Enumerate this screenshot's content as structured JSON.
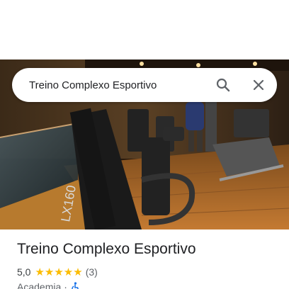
{
  "search": {
    "query": "Treino Complexo Esportivo",
    "search_icon": "search-icon",
    "close_icon": "close-icon"
  },
  "photo": {
    "subject": "gym-interior-photo"
  },
  "place": {
    "title": "Treino Complexo Esportivo",
    "rating": "5,0",
    "stars": "★★★★★",
    "star_value": 5,
    "review_count": "(3)",
    "category": "Academia",
    "separator": "·",
    "accessibility_icon": "wheelchair-accessible-icon"
  },
  "colors": {
    "star": "#fbbc04",
    "accessibility": "#1a73e8",
    "title": "#202124",
    "secondary": "#5f6368"
  }
}
